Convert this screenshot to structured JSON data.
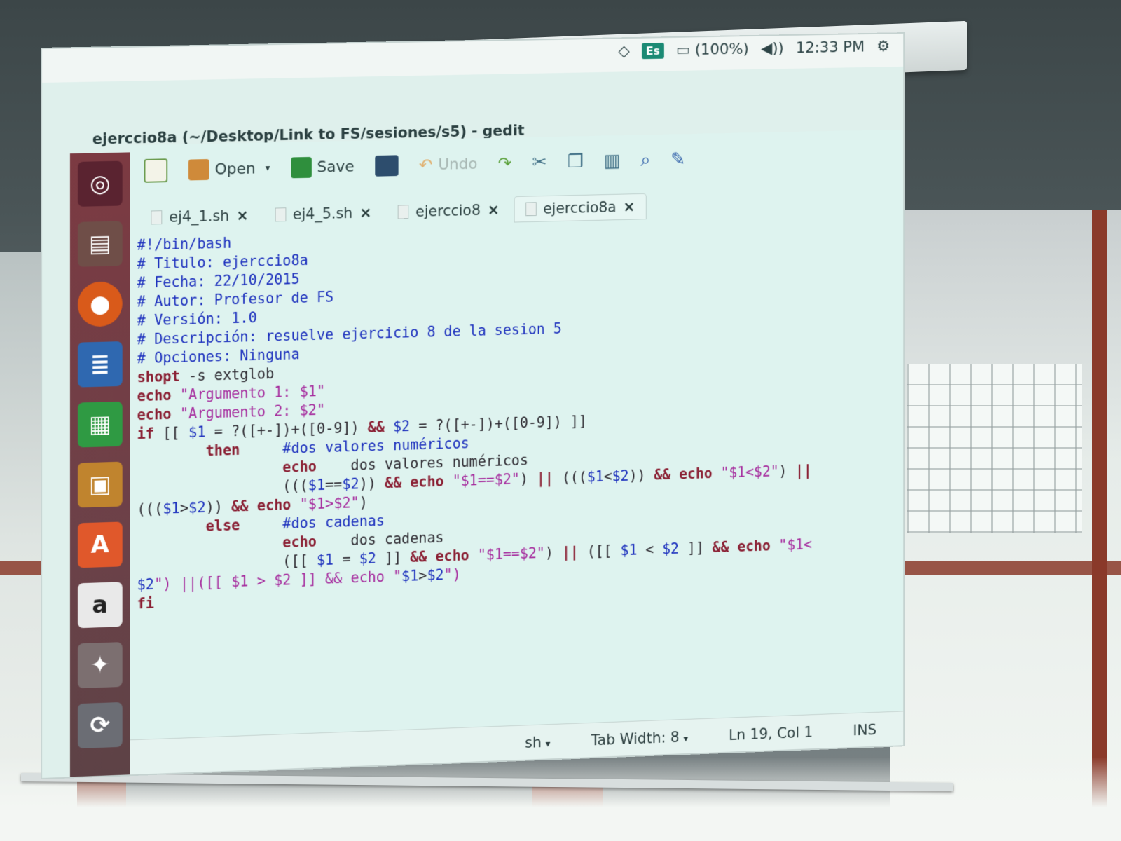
{
  "system": {
    "keyboard_layout": "Es",
    "battery": "(100%)",
    "time": "12:33 PM"
  },
  "window": {
    "title": "ejerccio8a (~/Desktop/Link to FS/sesiones/s5) - gedit"
  },
  "toolbar": {
    "open_label": "Open",
    "save_label": "Save",
    "undo_label": "Undo"
  },
  "tabs": [
    {
      "label": "ej4_1.sh",
      "close": "×"
    },
    {
      "label": "ej4_5.sh",
      "close": "×"
    },
    {
      "label": "ejerccio8",
      "close": "×"
    },
    {
      "label": "ejerccio8a",
      "close": "×"
    }
  ],
  "code": [
    "#!/bin/bash",
    "# Titulo: ejerccio8a",
    "# Fecha: 22/10/2015",
    "# Autor: Profesor de FS",
    "# Versión: 1.0",
    "# Descripción: resuelve ejercicio 8 de la sesion 5",
    "# Opciones: Ninguna",
    "shopt -s extglob",
    "echo \"Argumento 1: $1\"",
    "echo \"Argumento 2: $2\"",
    "if [[ $1 = ?([+-])+([0-9]) && $2 = ?([+-])+([0-9]) ]]",
    "        then     #dos valores numéricos",
    "                 echo    dos valores numéricos",
    "                 ((($1==$2)) && echo \"$1==$2\") || ((($1<$2)) && echo \"$1<$2\") ||",
    "((($1>$2)) && echo \"$1>$2\")",
    "        else     #dos cadenas",
    "                 echo    dos cadenas",
    "                 ([[ $1 = $2 ]] && echo \"$1==$2\") || ([[ $1 < $2 ]] && echo \"$1<",
    "$2\") ||([[ $1 > $2 ]] && echo \"$1>$2\")",
    "fi"
  ],
  "status": {
    "language": "sh",
    "tab_width": "Tab Width: 8",
    "position": "Ln 19, Col 1",
    "mode": "INS"
  }
}
